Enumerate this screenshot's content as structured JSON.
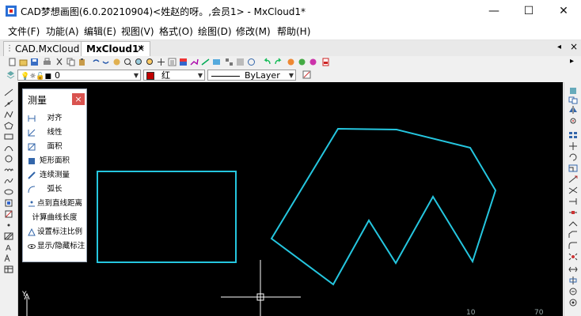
{
  "window": {
    "title": "CAD梦想画图(6.0.20210904)<姓赵的呀。,会员1> - MxCloud1*",
    "minimize_glyph": "—",
    "maximize_glyph": "☐",
    "close_glyph": "✕"
  },
  "menu": {
    "items": [
      "文件(F)",
      "功能(A)",
      "编辑(E)",
      "视图(V)",
      "格式(O)",
      "绘图(D)",
      "修改(M)",
      "帮助(H)"
    ]
  },
  "tabs": {
    "items": [
      "CAD.MxCloud",
      "MxCloud1*"
    ],
    "active_index": 1,
    "close_glyph": "×"
  },
  "properties_bar": {
    "layer_value": "0",
    "color_value": "红",
    "color_swatch": "#c00000",
    "linetype_value": "ByLayer"
  },
  "measure_panel": {
    "title": "测量",
    "close_glyph": "×",
    "items": [
      "对齐",
      "线性",
      "面积",
      "矩形面积",
      "连续测量",
      "弧长",
      "点到直线距离",
      "计算曲线长度",
      "设置标注比例",
      "显示/隐藏标注"
    ]
  },
  "canvas": {
    "background": "#000000",
    "shape_color": "#25c6df",
    "axis_label": "Y",
    "coord_labels": [
      "10",
      "70"
    ]
  },
  "icons": {
    "app": "cad-app-icon",
    "toolbar": [
      "new-file-icon",
      "open-file-icon",
      "save-icon",
      "print-icon",
      "cut-icon",
      "copy-icon",
      "paste-icon",
      "undo-icon",
      "redo-icon",
      "pan-icon",
      "zoom-icon",
      "zoom-window-icon",
      "zoom-extents-icon",
      "properties-icon",
      "layer-icon",
      "measure-icon",
      "copy-prop-icon",
      "grip-icon",
      "undo-arrow-icon",
      "redo-arrow-icon",
      "block-icon",
      "image-icon",
      "pdf-icon"
    ]
  }
}
